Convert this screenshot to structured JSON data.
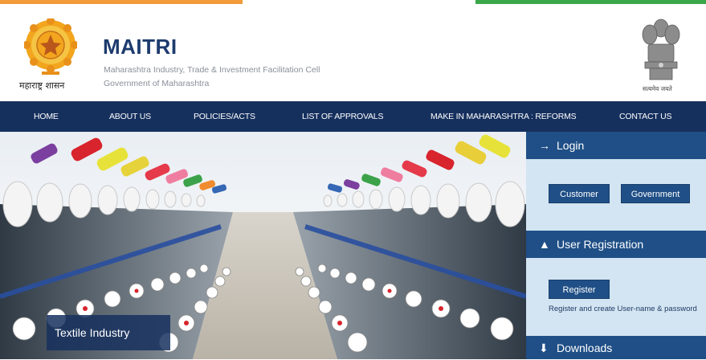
{
  "colors": {
    "saffron": "#f39a3a",
    "green": "#3aa84a",
    "nav_bg": "#16305e",
    "panel_head": "#1f4f86",
    "panel_bg": "#d3e5f2",
    "brand_text": "#1d3b6e"
  },
  "header": {
    "state_text": "महाराष्ट्र शासन",
    "brand_title": "MAITRI",
    "brand_subtitle": "Maharashtra Industry, Trade & Investment Facilitation Cell",
    "brand_government": "Government of Maharashtra",
    "emblem_right_text": "सत्यमेव जयते"
  },
  "nav": {
    "items": [
      {
        "label": "HOME"
      },
      {
        "label": "ABOUT US"
      },
      {
        "label": "POLICIES/ACTS"
      },
      {
        "label": "LIST OF APPROVALS"
      },
      {
        "label": "MAKE IN MAHARASHTRA : REFORMS"
      },
      {
        "label": "CONTACT US"
      }
    ]
  },
  "hero": {
    "caption": "Textile Industry"
  },
  "sidebar": {
    "login": {
      "title": "Login",
      "icon": "login-icon",
      "customer_label": "Customer",
      "government_label": "Government"
    },
    "registration": {
      "title": "User Registration",
      "icon": "user-icon",
      "register_label": "Register",
      "note": "Register and create User-name & password"
    },
    "downloads": {
      "title": "Downloads",
      "icon": "downloads-icon"
    }
  }
}
